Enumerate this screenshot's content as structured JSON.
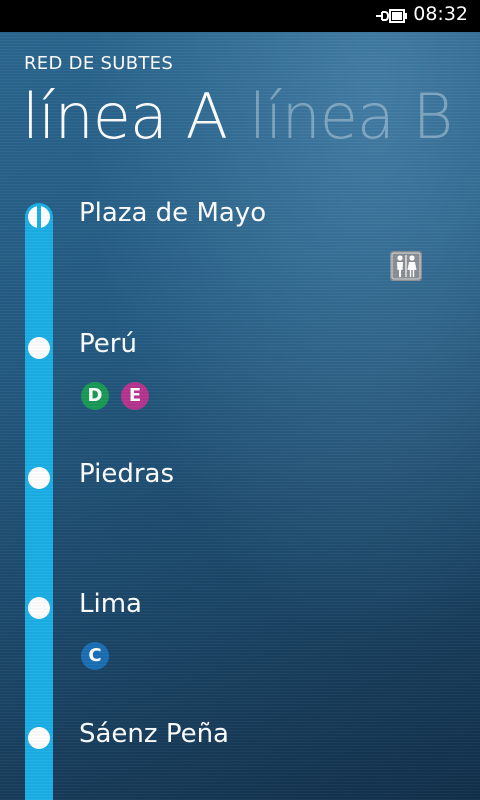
{
  "status_bar": {
    "time": "08:32",
    "battery_icon": "battery-charging-icon"
  },
  "app_title": "RED DE SUBTES",
  "pivot": {
    "items": [
      "línea A",
      "línea B"
    ],
    "selected": 0
  },
  "line": {
    "color": "#1bb0e6"
  },
  "stations": [
    {
      "name": "Plaza de Mayo",
      "amenities": [
        "restroom-icon"
      ]
    },
    {
      "name": "Perú",
      "connections": [
        {
          "letter": "D",
          "color": "#1a9b56"
        },
        {
          "letter": "E",
          "color": "#b5358f"
        }
      ]
    },
    {
      "name": "Piedras"
    },
    {
      "name": "Lima",
      "connections": [
        {
          "letter": "C",
          "color": "#1b6fb5"
        }
      ]
    },
    {
      "name": "Sáenz Peña"
    }
  ]
}
